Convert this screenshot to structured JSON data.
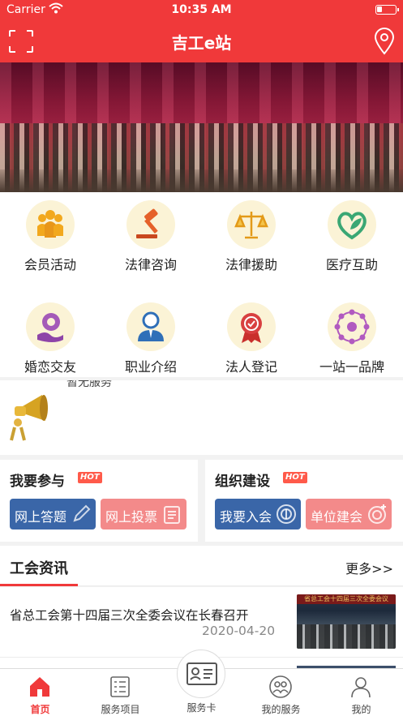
{
  "status_bar": {
    "carrier": "Carrier",
    "time": "10:35 AM"
  },
  "nav": {
    "title": "吉工e站",
    "left_icon": "scan-icon",
    "right_icon": "location-pin-icon"
  },
  "services": [
    {
      "label": "会员活动",
      "icon": "member-activity-icon"
    },
    {
      "label": "法律咨询",
      "icon": "gavel-icon"
    },
    {
      "label": "法律援助",
      "icon": "scales-icon"
    },
    {
      "label": "医疗互助",
      "icon": "heart-leaf-icon"
    },
    {
      "label": "婚恋交友",
      "icon": "flower-hand-icon"
    },
    {
      "label": "职业介绍",
      "icon": "employee-icon"
    },
    {
      "label": "法人登记",
      "icon": "badge-ribbon-icon"
    },
    {
      "label": "一站一品牌",
      "icon": "ring-emblem-icon"
    }
  ],
  "notice": {
    "text": "暂无服务",
    "icon": "megaphone-icon"
  },
  "participate": {
    "title": "我要参与",
    "hot": "HOT",
    "buttons": [
      {
        "label": "网上答题",
        "icon": "pencil-icon"
      },
      {
        "label": "网上投票",
        "icon": "clipboard-icon"
      }
    ]
  },
  "organization": {
    "title": "组织建设",
    "hot": "HOT",
    "buttons": [
      {
        "label": "我要入会",
        "icon": "union-emblem-icon"
      },
      {
        "label": "单位建会",
        "icon": "union-emblem-plus-icon"
      }
    ]
  },
  "news": {
    "title": "工会资讯",
    "more": "更多>>",
    "items": [
      {
        "title": "省总工会第十四届三次全委会议在长春召开",
        "date": "2020-04-20",
        "thumb_caption": "省总工会十四届三次全委会议"
      }
    ]
  },
  "tabbar": [
    {
      "label": "首页",
      "icon": "home-icon",
      "active": true
    },
    {
      "label": "服务项目",
      "icon": "list-icon",
      "active": false
    },
    {
      "label": "服务卡",
      "icon": "id-card-icon",
      "active": false
    },
    {
      "label": "我的服务",
      "icon": "people-icon",
      "active": false
    },
    {
      "label": "我的",
      "icon": "person-icon",
      "active": false
    }
  ],
  "colors": {
    "brand_red": "#f0393a",
    "blue_button": "#3a66a8",
    "pink_button": "#f38a8a",
    "icon_bg": "#fbf3d6"
  }
}
